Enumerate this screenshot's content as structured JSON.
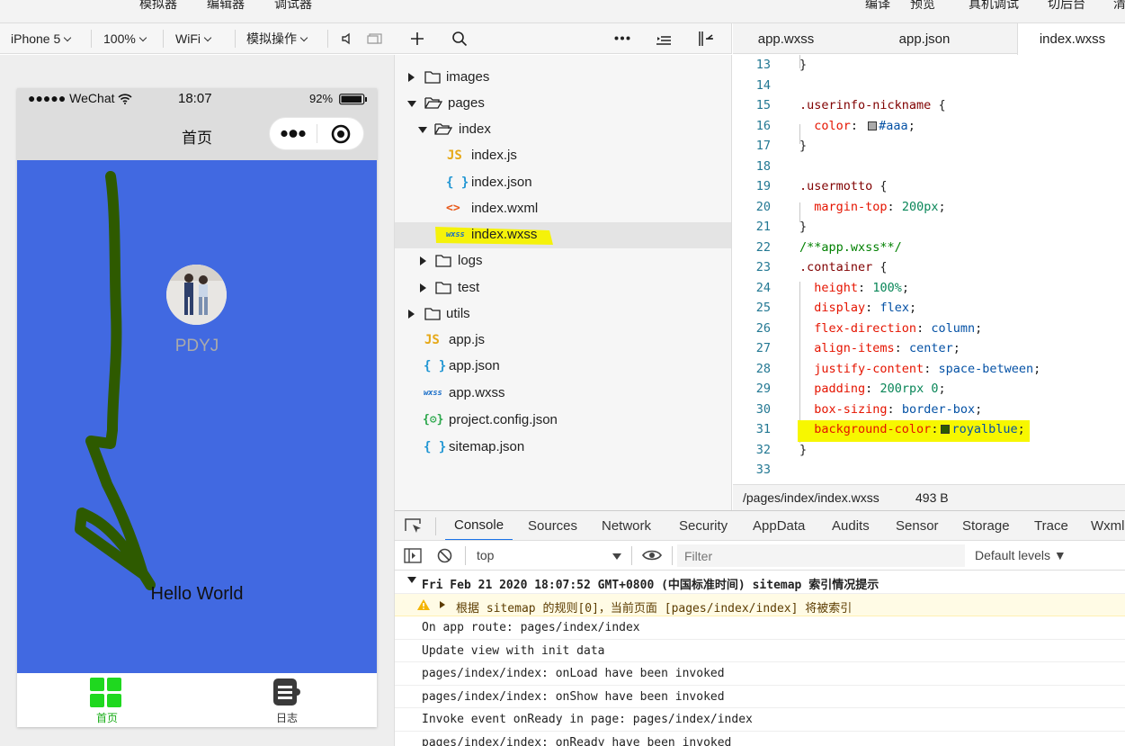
{
  "menubar": {
    "left": [
      "模拟器",
      "编辑器",
      "调试器"
    ],
    "right": [
      "编译",
      "预览",
      "真机调试",
      "切后台",
      "清"
    ]
  },
  "sim_toolbar": {
    "device": "iPhone 5",
    "zoom": "100%",
    "network": "WiFi",
    "operation": "模拟操作"
  },
  "phone": {
    "status": {
      "carrier": "●●●●● WeChat",
      "time": "18:07",
      "battery": "92%"
    },
    "nav_title": "首页",
    "nickname": "PDYJ",
    "motto": "Hello World",
    "tabbar": [
      {
        "label": "首页",
        "color": "#1aad19"
      },
      {
        "label": "日志",
        "color": "#333333"
      }
    ],
    "page_bg": "#4169e1"
  },
  "file_tree": [
    {
      "label": "images",
      "type": "folder",
      "expanded": false
    },
    {
      "label": "pages",
      "type": "folder",
      "expanded": true
    },
    {
      "label": "index",
      "type": "folder",
      "expanded": true
    },
    {
      "label": "index.js",
      "type": "js",
      "icon": "JS"
    },
    {
      "label": "index.json",
      "type": "json",
      "icon": "{ }"
    },
    {
      "label": "index.wxml",
      "type": "wxml",
      "icon": "<>"
    },
    {
      "label": "index.wxss",
      "type": "wxss",
      "icon": "wxss",
      "selected": true
    },
    {
      "label": "logs",
      "type": "folder",
      "expanded": false
    },
    {
      "label": "test",
      "type": "folder",
      "expanded": false
    },
    {
      "label": "utils",
      "type": "folder",
      "expanded": false
    },
    {
      "label": "app.js",
      "type": "js",
      "icon": "JS"
    },
    {
      "label": "app.json",
      "type": "json",
      "icon": "{ }"
    },
    {
      "label": "app.wxss",
      "type": "wxss",
      "icon": "wxss"
    },
    {
      "label": "project.config.json",
      "type": "config",
      "icon": "{⚙}"
    },
    {
      "label": "sitemap.json",
      "type": "json",
      "icon": "{ }"
    }
  ],
  "editor_tabs": [
    "app.wxss",
    "app.json",
    "index.wxss"
  ],
  "code_lines": [
    {
      "n": "13",
      "html": "}"
    },
    {
      "n": "14",
      "html": ""
    },
    {
      "n": "15",
      "html": "<span class='sel'>.userinfo-nickname</span> {"
    },
    {
      "n": "16",
      "html": "  <span class='prop'>color</span>: <span class='swatch' style='background:#aaa'></span><span class='val'>#aaa</span>;"
    },
    {
      "n": "17",
      "html": "}"
    },
    {
      "n": "18",
      "html": ""
    },
    {
      "n": "19",
      "html": "<span class='sel'>.usermotto</span> {"
    },
    {
      "n": "20",
      "html": "  <span class='prop'>margin-top</span>: <span class='num'>200px</span>;"
    },
    {
      "n": "21",
      "html": "}"
    },
    {
      "n": "22",
      "html": "<span class='cmt'>/**app.wxss**/</span>"
    },
    {
      "n": "23",
      "html": "<span class='sel'>.container</span> {"
    },
    {
      "n": "24",
      "html": "  <span class='prop'>height</span>: <span class='num'>100%</span>;"
    },
    {
      "n": "25",
      "html": "  <span class='prop'>display</span>: <span class='val'>flex</span>;"
    },
    {
      "n": "26",
      "html": "  <span class='prop'>flex-direction</span>: <span class='val'>column</span>;"
    },
    {
      "n": "27",
      "html": "  <span class='prop'>align-items</span>: <span class='val'>center</span>;"
    },
    {
      "n": "28",
      "html": "  <span class='prop'>justify-content</span>: <span class='val'>space-between</span>;"
    },
    {
      "n": "29",
      "html": "  <span class='prop'>padding</span>: <span class='num'>200rpx 0</span>;"
    },
    {
      "n": "30",
      "html": "  <span class='prop'>box-sizing</span>: <span class='val'>border-box</span>;"
    },
    {
      "n": "31",
      "html": "  <span class='prop'>background-color</span>:<span class='swatch' style='background:#2e5a00'></span><span class='val'>royalblue</span>;",
      "highlight": true
    },
    {
      "n": "32",
      "html": "}"
    },
    {
      "n": "33",
      "html": ""
    }
  ],
  "code_status": {
    "path": "/pages/index/index.wxss",
    "size": "493 B"
  },
  "devtools_tabs": [
    "Console",
    "Sources",
    "Network",
    "Security",
    "AppData",
    "Audits",
    "Sensor",
    "Storage",
    "Trace",
    "Wxml"
  ],
  "console_toolbar": {
    "context": "top",
    "filter_placeholder": "Filter",
    "levels": "Default levels ▼"
  },
  "console_logs": [
    {
      "text": "Fri Feb 21 2020 18:07:52 GMT+0800 (中国标准时间) sitemap 索引情况提示",
      "kind": "group"
    },
    {
      "text": "根据 sitemap 的规则[0]，当前页面 [pages/index/index] 将被索引",
      "kind": "warn"
    },
    {
      "text": "On app route: pages/index/index",
      "kind": "log"
    },
    {
      "text": "Update view with init data",
      "kind": "log"
    },
    {
      "text": "pages/index/index: onLoad have been invoked",
      "kind": "log"
    },
    {
      "text": "pages/index/index: onShow have been invoked",
      "kind": "log"
    },
    {
      "text": "Invoke event onReady in page: pages/index/index",
      "kind": "log"
    },
    {
      "text": "pages/index/index: onReady have been invoked",
      "kind": "log"
    }
  ]
}
